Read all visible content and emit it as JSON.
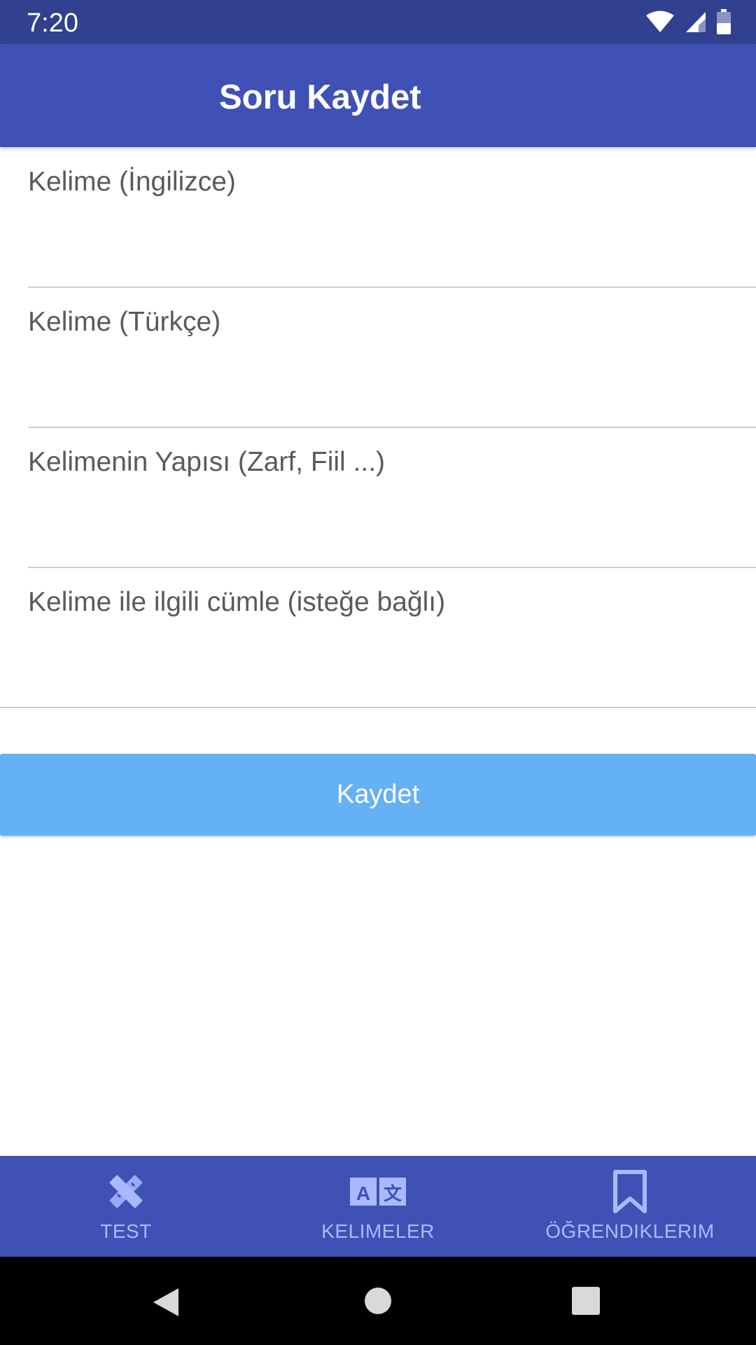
{
  "status_bar": {
    "time": "7:20",
    "icons": [
      "wifi-icon",
      "signal-icon",
      "battery-icon"
    ]
  },
  "app_bar": {
    "title": "Soru Kaydet"
  },
  "form": {
    "fields": [
      {
        "placeholder": "Kelime (İngilizce)",
        "value": ""
      },
      {
        "placeholder": "Kelime (Türkçe)",
        "value": ""
      },
      {
        "placeholder": "Kelimenin Yapısı (Zarf, Fiil ...)",
        "value": ""
      },
      {
        "placeholder": "Kelime ile ilgili cümle (isteğe bağlı)",
        "value": ""
      }
    ],
    "save_label": "Kaydet"
  },
  "bottom_nav": {
    "items": [
      {
        "label": "TEST",
        "icon": "pencil-ruler-icon"
      },
      {
        "label": "KELIMELER",
        "icon": "translate-icon"
      },
      {
        "label": "ÖĞRENDIKLERIM",
        "icon": "bookmark-icon"
      }
    ]
  },
  "system_nav": {
    "icons": [
      "back-icon",
      "home-icon",
      "recents-icon"
    ]
  },
  "colors": {
    "primary": "#3f51b5",
    "primary_dark": "#31408f",
    "button": "#64b1f6",
    "nav_inactive": "#aab9ff"
  }
}
